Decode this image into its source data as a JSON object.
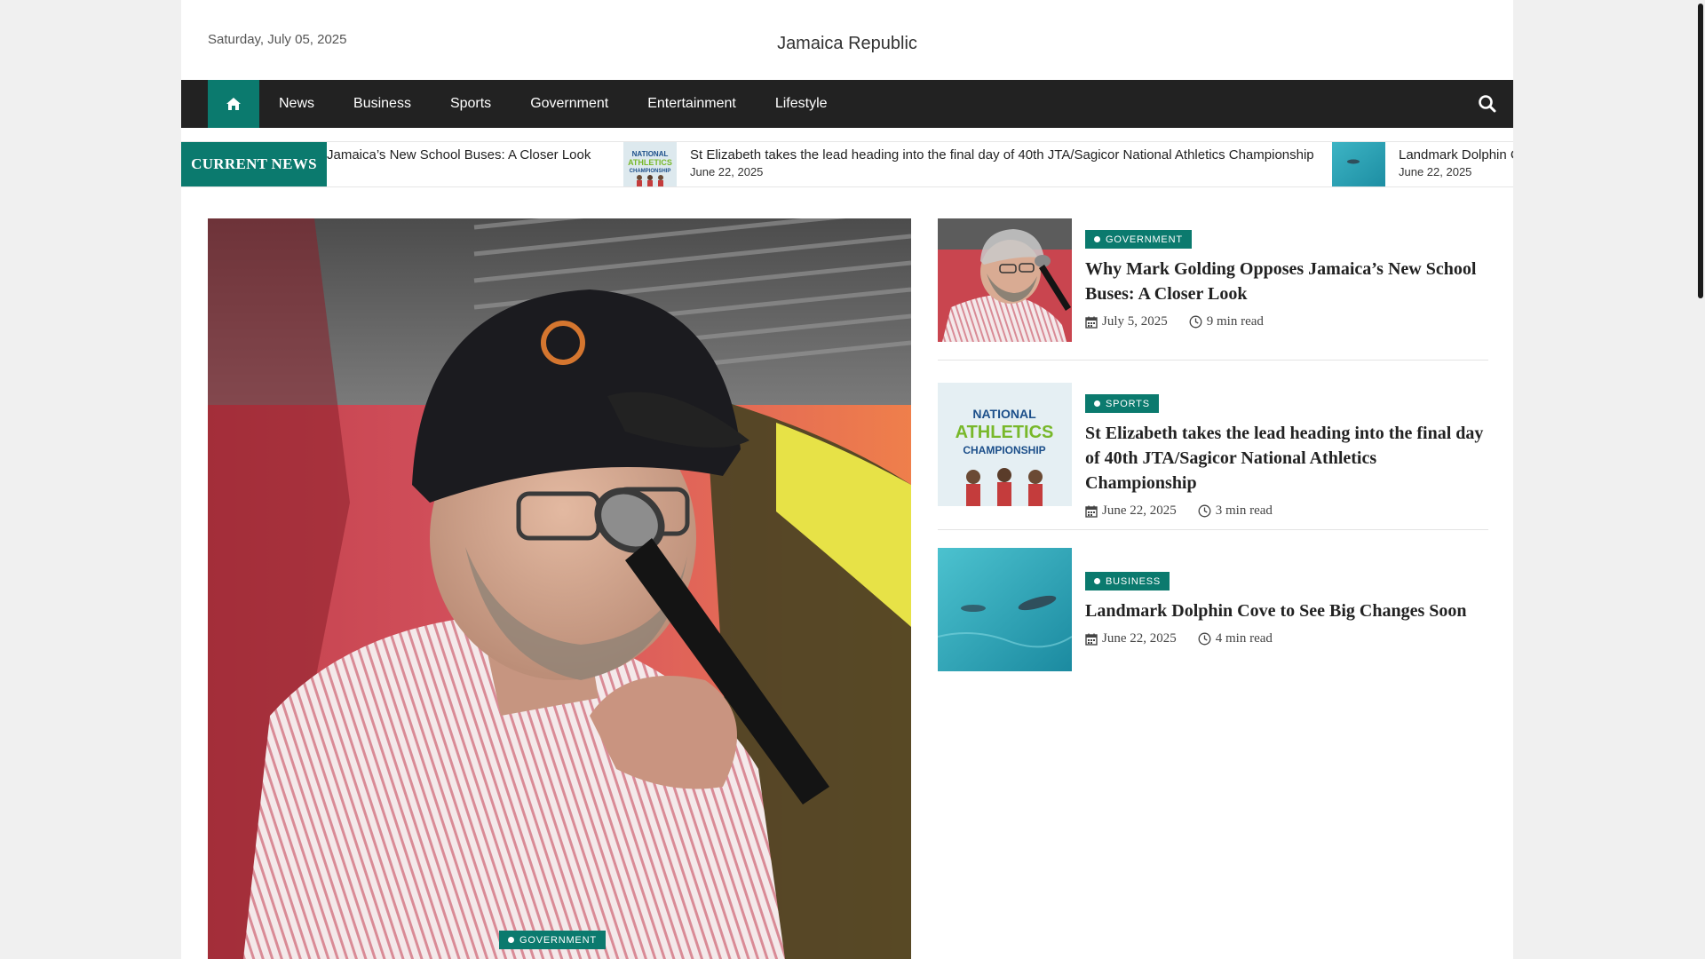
{
  "header": {
    "date": "Saturday, July 05, 2025",
    "site_title": "Jamaica Republic"
  },
  "nav": {
    "home_icon": "home-icon",
    "items": [
      "News",
      "Business",
      "Sports",
      "Government",
      "Entertainment",
      "Lifestyle"
    ],
    "search_icon": "search-icon"
  },
  "ticker": {
    "label": "CURRENT NEWS",
    "items": [
      {
        "title": "Why Mark Golding Opposes Jamaica’s New School Buses: A Closer Look",
        "visible_title": "Jamaica’s New School Buses: A Closer Look",
        "date": ""
      },
      {
        "title": "St Elizabeth takes the lead heading into the final day of 40th JTA/Sagicor National Athletics Championship",
        "date": "June 22, 2025"
      },
      {
        "title": "Landmark Dolphin C",
        "date": "June 22, 2025"
      }
    ]
  },
  "hero": {
    "category": "GOVERNMENT"
  },
  "side": {
    "items": [
      {
        "category": "GOVERNMENT",
        "title": "Why Mark Golding Opposes Jamaica’s New School Buses: A Closer Look",
        "date": "July 5, 2025",
        "read": "9 min read"
      },
      {
        "category": "SPORTS",
        "title": "St Elizabeth takes the lead heading into the final day of 40th JTA/Sagicor National Athletics Championship",
        "date": "June 22, 2025",
        "read": "3 min read",
        "thumb_text": [
          "NATIONAL",
          "ATHLETICS",
          "CHAMPIONSHIP"
        ]
      },
      {
        "category": "BUSINESS",
        "title": "Landmark Dolphin Cove to See Big Changes Soon",
        "date": "June 22, 2025",
        "read": "4 min read"
      }
    ]
  },
  "colors": {
    "accent": "#0b7a6e",
    "nav_bg": "#222222"
  }
}
